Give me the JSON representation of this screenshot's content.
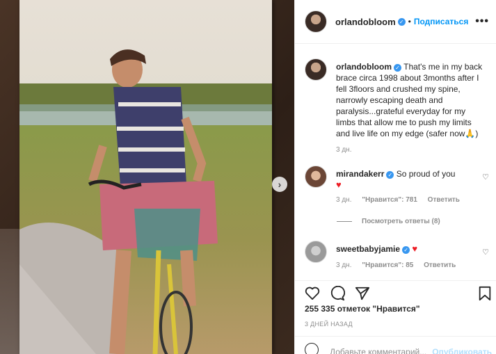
{
  "post": {
    "username": "orlandobloom",
    "follow_label": "Подписаться",
    "more_label": "•••",
    "carousel_next": "›"
  },
  "caption": {
    "username": "orlandobloom",
    "text": "That's me in my back brace circa 1998 about 3months after I fell 3floors and crushed my spine, narrowly escaping death and paralysis...grateful everyday for my limbs that allow me to push my limits and live life on my edge (safer now🙏)",
    "time": "3 дн."
  },
  "comments": [
    {
      "username": "mirandakerr",
      "text": "So proud of you",
      "emoji": "♥",
      "time": "3 дн.",
      "likes": "\"Нравится\": 781",
      "reply": "Ответить"
    },
    {
      "username": "sweetbabyjamie",
      "text": "",
      "emoji": "♥",
      "time": "3 дн.",
      "likes": "\"Нравится\": 85",
      "reply": "Ответить"
    }
  ],
  "view_replies": "Посмотреть ответы (8)",
  "likes_count": "255 335 отметок \"Нравится\"",
  "date": "3 ДНЕЙ НАЗАД",
  "add_comment": {
    "placeholder": "Добавьте комментарий...",
    "publish_label": "Опубликовать"
  },
  "icons": {
    "like": "heart-icon",
    "comment": "comment-icon",
    "share": "paper-plane-icon",
    "save": "bookmark-icon"
  },
  "colors": {
    "link_blue": "#0095f6",
    "verified_blue": "#3897f0",
    "muted": "#8e8e8e",
    "heart_red": "#ed1c24"
  }
}
